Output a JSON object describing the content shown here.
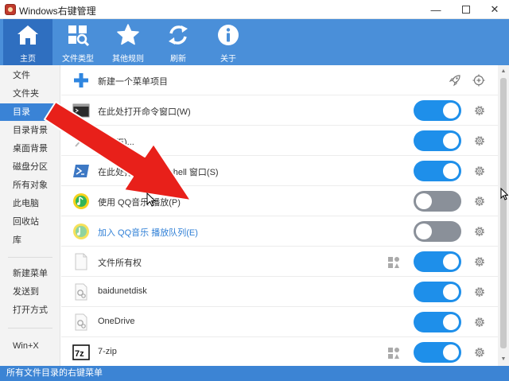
{
  "window": {
    "title": "Windows右键管理",
    "minimize": "—",
    "close": "✕"
  },
  "toolbar": {
    "items": [
      {
        "label": "主页",
        "icon": "home-icon",
        "active": true
      },
      {
        "label": "文件类型",
        "icon": "file-types-icon"
      },
      {
        "label": "其他规则",
        "icon": "star-icon"
      },
      {
        "label": "刷新",
        "icon": "refresh-icon"
      },
      {
        "label": "关于",
        "icon": "info-icon"
      }
    ]
  },
  "sidebar": {
    "items": [
      {
        "label": "文件"
      },
      {
        "label": "文件夹"
      },
      {
        "label": "目录",
        "active": true
      },
      {
        "label": "目录背景"
      },
      {
        "label": "桌面背景"
      },
      {
        "label": "磁盘分区"
      },
      {
        "label": "所有对象"
      },
      {
        "label": "此电脑"
      },
      {
        "label": "回收站"
      },
      {
        "label": "库"
      },
      {
        "label": "新建菜单"
      },
      {
        "label": "发送到"
      },
      {
        "label": "打开方式"
      },
      {
        "label": "Win+X"
      }
    ]
  },
  "content": {
    "new_item": {
      "label": "新建一个菜单项目",
      "icon": "plus-icon",
      "actions": [
        "rocket-icon",
        "add-crosshair-icon"
      ]
    },
    "rows": [
      {
        "label": "在此处打开命令窗口(W)",
        "icon": "cmd-window-icon",
        "enabled": true
      },
      {
        "label": "搜索(E)...",
        "icon": "search-pen-icon",
        "enabled": true
      },
      {
        "label": "在此处打开 Powershell 窗口(S)",
        "icon": "powershell-icon",
        "enabled": true
      },
      {
        "label": "使用 QQ音乐 播放(P)",
        "icon": "qq-music-icon",
        "enabled": false
      },
      {
        "label": "加入 QQ音乐 播放队列(E)",
        "icon": "qq-music-light-icon",
        "enabled": false,
        "link": true
      },
      {
        "label": "文件所有权",
        "icon": "blank-file-icon",
        "enabled": true,
        "shapes": true
      },
      {
        "label": "baidunetdisk",
        "icon": "gear-file-icon",
        "enabled": true
      },
      {
        "label": "OneDrive",
        "icon": "gear-file-icon",
        "enabled": true
      },
      {
        "label": "7-zip",
        "icon": "7zip-icon",
        "enabled": true,
        "shapes": true
      }
    ]
  },
  "statusbar": {
    "text": "所有文件目录的右键菜单"
  },
  "overlay": {
    "arrow_color": "#e8201a"
  }
}
